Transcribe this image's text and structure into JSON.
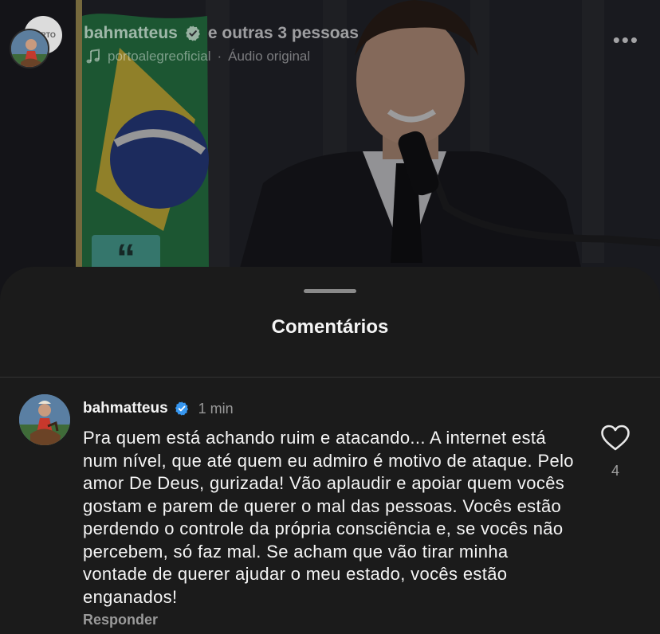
{
  "reel": {
    "authors": "bahmatteus",
    "others": "e outras 3 pessoas",
    "audio_source": "portoalegreoficial",
    "audio_separator": "·",
    "audio_label": "Áudio original",
    "more_label": "•••",
    "logo_text": "PORTO ALEGRE",
    "overlay_glyph": "“"
  },
  "sheet": {
    "title": "Comentários"
  },
  "comment": {
    "username": "bahmatteus",
    "time": "1 min",
    "text": "Pra quem está achando ruim e atacando... A internet está num nível, que até quem eu admiro é motivo de ataque. Pelo amor De Deus, gurizada! Vão aplaudir e apoiar quem vocês gostam e parem de querer o mal das pessoas. Vocês estão perdendo o controle da própria consciência e, se vocês não percebem, só faz mal. Se acham que vão tirar minha vontade de querer ajudar o meu estado, vocês estão enganados!",
    "reply_label": "Responder",
    "like_count": "4"
  },
  "icons": {
    "verified": "verified-badge-icon",
    "music": "music-note-icon",
    "heart": "heart-outline-icon",
    "more": "more-horizontal-icon"
  },
  "colors": {
    "sheet_bg": "#1b1b1b",
    "verified_blue": "#3797f0",
    "muted_text": "#9a9a9a"
  }
}
